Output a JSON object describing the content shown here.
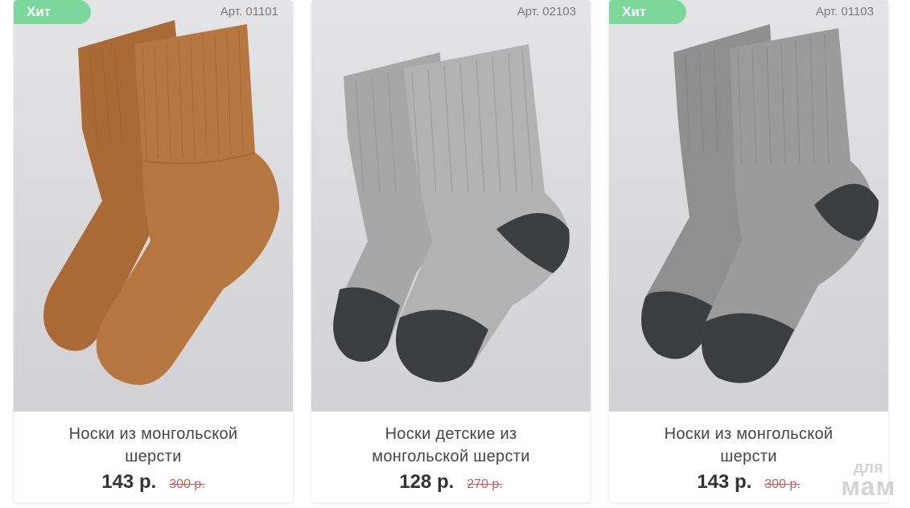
{
  "colors": {
    "badge_bg": "#7bd89a",
    "old_price": "#c06060",
    "wool_brown": "#b5773f",
    "wool_grey_light": "#b2b2b2",
    "wool_grey": "#9b9b9b",
    "heel_dark": "#3b3d3f"
  },
  "products": [
    {
      "badge": "Хит",
      "article": "Арт. 01101",
      "title": "Носки из монгольской шерсти",
      "price": "143 р.",
      "old_price": "300 р.",
      "image": "brown-wool-socks"
    },
    {
      "badge": "",
      "article": "Арт. 02103",
      "title": "Носки детские из монгольской шерсти",
      "price": "128 р.",
      "old_price": "270 р.",
      "image": "grey-kids-wool-socks"
    },
    {
      "badge": "Хит",
      "article": "Арт. 01103",
      "title": "Носки из монгольской шерсти",
      "price": "143 р.",
      "old_price": "300 р.",
      "image": "grey-wool-socks"
    }
  ],
  "watermark": {
    "line1": "для",
    "line2": "мам"
  }
}
